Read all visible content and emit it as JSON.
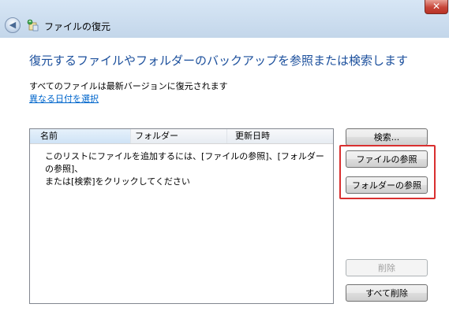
{
  "window": {
    "close_label": "✕",
    "title": "ファイルの復元"
  },
  "icons": {
    "back": "back-arrow-icon",
    "app": "file-restore-icon",
    "close": "close-icon"
  },
  "main": {
    "heading": "復元するファイルやフォルダーのバックアップを参照または検索します",
    "info_text": "すべてのファイルは最新バージョンに復元されます",
    "date_link": "異なる日付を選択"
  },
  "list": {
    "columns": [
      "名前",
      "フォルダー",
      "更新日時"
    ],
    "empty_message_line1": "このリストにファイルを追加するには、[ファイルの参照]、[フォルダーの参照]、",
    "empty_message_line2": "または[検索]をクリックしてください"
  },
  "buttons": {
    "search": "検索...",
    "browse_files": "ファイルの参照",
    "browse_folders": "フォルダーの参照",
    "delete": "削除",
    "delete_all": "すべて削除"
  },
  "colors": {
    "heading": "#1b4f9c",
    "link": "#0066cc",
    "highlight": "#d92f2f"
  }
}
